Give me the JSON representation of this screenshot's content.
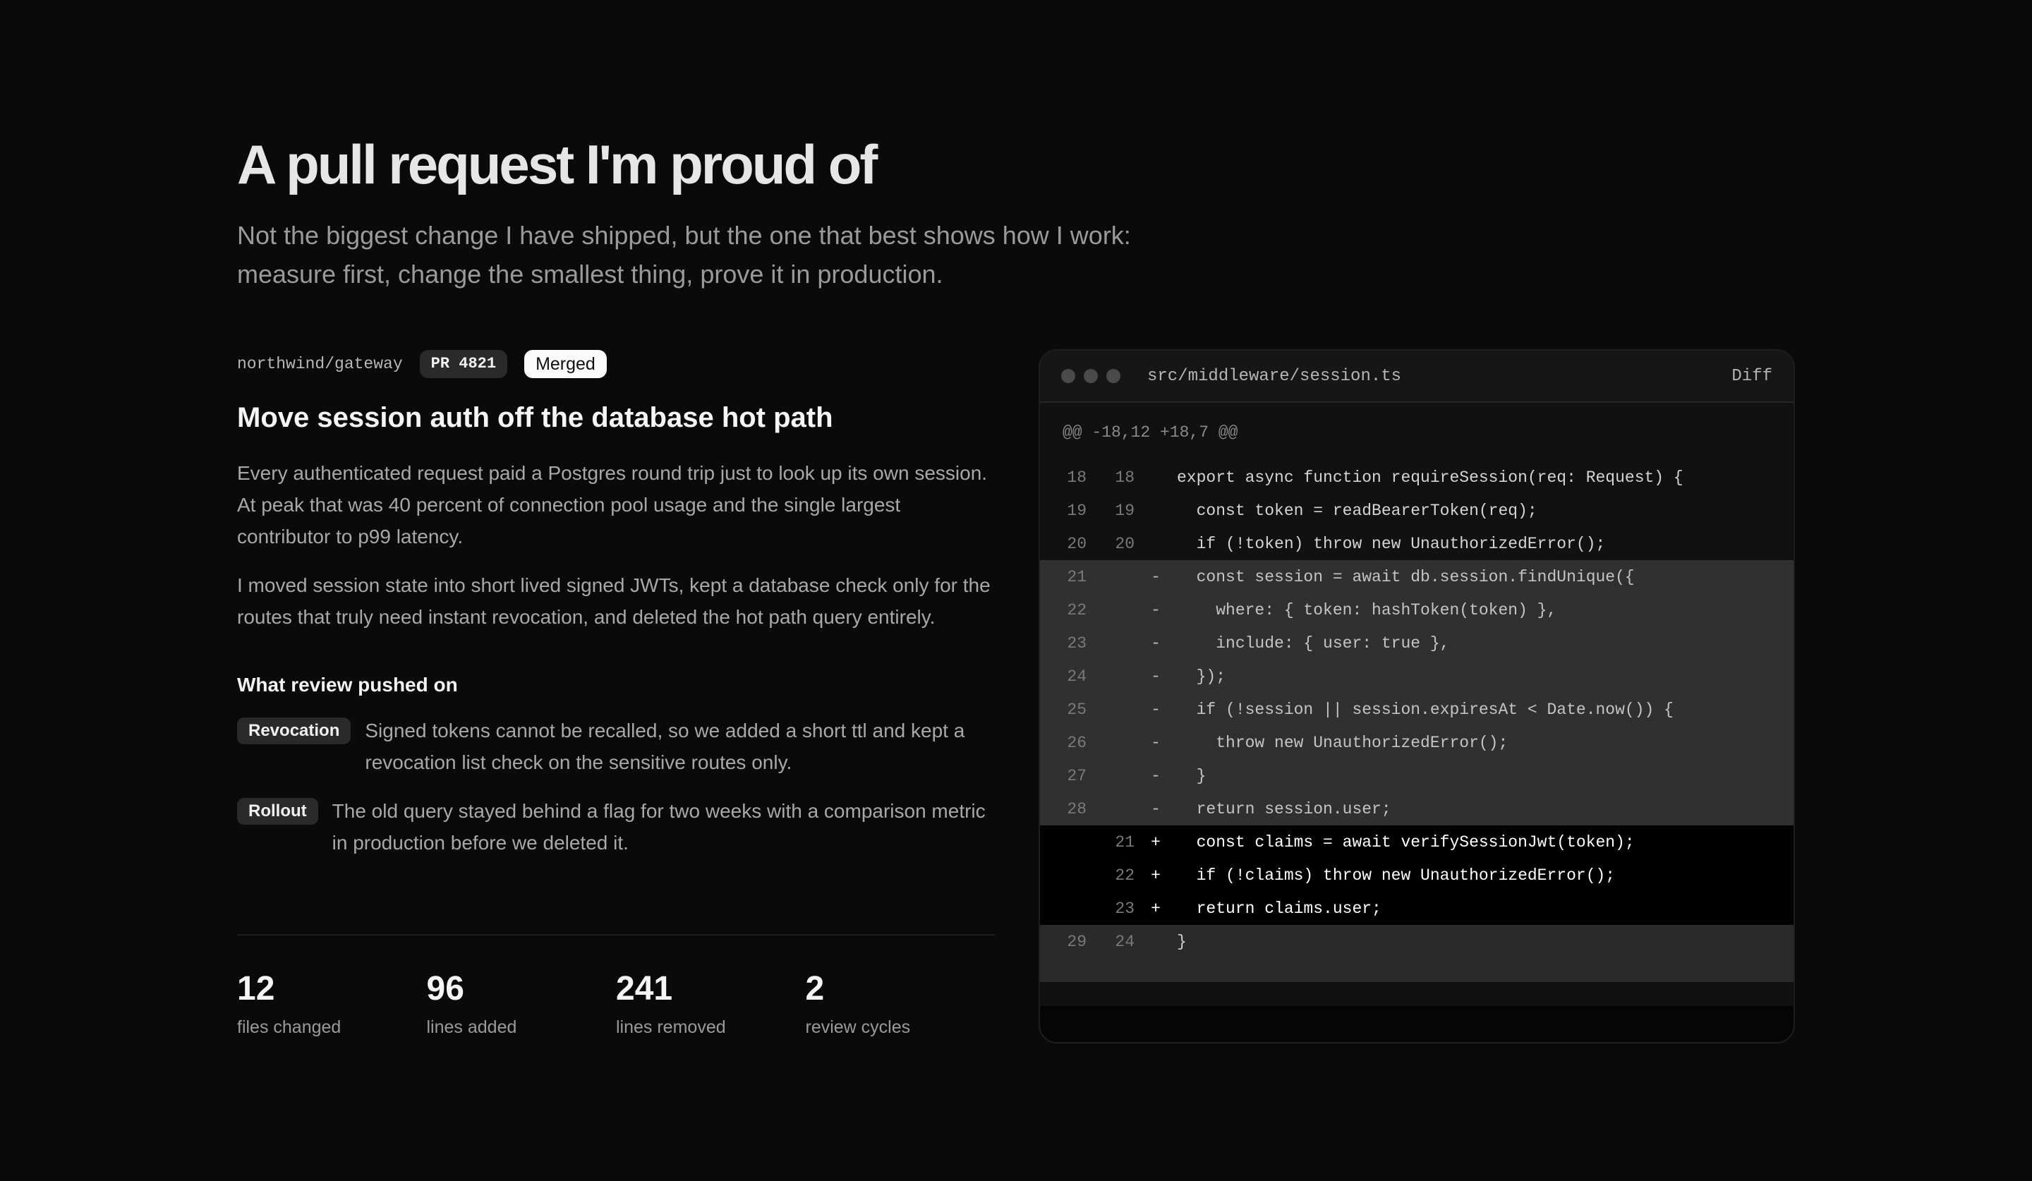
{
  "hero": {
    "title": "A pull request I'm proud of",
    "subtitle": "Not the biggest change I have shipped, but the one that best shows how I work: measure first, change the smallest thing, prove it in production."
  },
  "pr": {
    "repo": "northwind/gateway",
    "number_label": "PR 4821",
    "status": "Merged",
    "title": "Move session auth off the database hot path",
    "paragraphs": [
      "Every authenticated request paid a Postgres round trip just to look up its own session. At peak that was 40 percent of connection pool usage and the single largest contributor to p99 latency.",
      "I moved session state into short lived signed JWTs, kept a database check only for the routes that truly need instant revocation, and deleted the hot path query entirely."
    ],
    "review_heading": "What review pushed on",
    "review_items": [
      {
        "tag": "Revocation",
        "text": "Signed tokens cannot be recalled, so we added a short ttl and kept a revocation list check on the sensitive routes only."
      },
      {
        "tag": "Rollout",
        "text": "The old query stayed behind a flag for two weeks with a comparison metric in production before we deleted it."
      }
    ]
  },
  "stats": [
    {
      "value": "12",
      "label": "files changed"
    },
    {
      "value": "96",
      "label": "lines added"
    },
    {
      "value": "241",
      "label": "lines removed"
    },
    {
      "value": "2",
      "label": "review cycles"
    }
  ],
  "code": {
    "filename": "src/middleware/session.ts",
    "mode_label": "Diff",
    "hunk_header": "@@ -18,12 +18,7 @@",
    "lines": [
      {
        "type": "ctx",
        "old": "18",
        "new": "18",
        "sign": "",
        "text": "export async function requireSession(req: Request) {"
      },
      {
        "type": "ctx",
        "old": "19",
        "new": "19",
        "sign": "",
        "text": "  const token = readBearerToken(req);"
      },
      {
        "type": "ctx",
        "old": "20",
        "new": "20",
        "sign": "",
        "text": "  if (!token) throw new UnauthorizedError();"
      },
      {
        "type": "del",
        "old": "21",
        "new": "",
        "sign": "-",
        "text": "  const session = await db.session.findUnique({"
      },
      {
        "type": "del",
        "old": "22",
        "new": "",
        "sign": "-",
        "text": "    where: { token: hashToken(token) },"
      },
      {
        "type": "del",
        "old": "23",
        "new": "",
        "sign": "-",
        "text": "    include: { user: true },"
      },
      {
        "type": "del",
        "old": "24",
        "new": "",
        "sign": "-",
        "text": "  });"
      },
      {
        "type": "del",
        "old": "25",
        "new": "",
        "sign": "-",
        "text": "  if (!session || session.expiresAt < Date.now()) {"
      },
      {
        "type": "del",
        "old": "26",
        "new": "",
        "sign": "-",
        "text": "    throw new UnauthorizedError();"
      },
      {
        "type": "del",
        "old": "27",
        "new": "",
        "sign": "-",
        "text": "  }"
      },
      {
        "type": "del",
        "old": "28",
        "new": "",
        "sign": "-",
        "text": "  return session.user;"
      },
      {
        "type": "add",
        "old": "",
        "new": "21",
        "sign": "+",
        "text": "  const claims = await verifySessionJwt(token);"
      },
      {
        "type": "add",
        "old": "",
        "new": "22",
        "sign": "+",
        "text": "  if (!claims) throw new UnauthorizedError();"
      },
      {
        "type": "add",
        "old": "",
        "new": "23",
        "sign": "+",
        "text": "  return claims.user;"
      },
      {
        "type": "tail",
        "old": "29",
        "new": "24",
        "sign": "",
        "text": "}"
      }
    ]
  }
}
